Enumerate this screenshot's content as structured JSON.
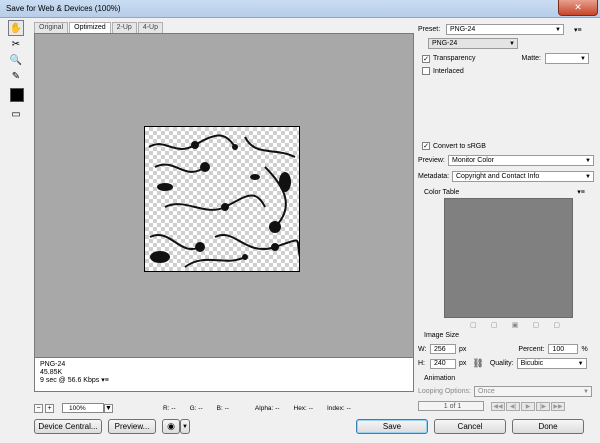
{
  "window": {
    "title": "Save for Web & Devices (100%)"
  },
  "view_tabs": [
    "Original",
    "Optimized",
    "2-Up",
    "4-Up"
  ],
  "info": {
    "format": "PNG-24",
    "size": "45.85K",
    "time": "9 sec @ 56.6 Kbps"
  },
  "zoom": {
    "value": "100%",
    "minus": "−",
    "plus": "+"
  },
  "readouts": {
    "r": "R: --",
    "g": "G: --",
    "b": "B: --",
    "alpha": "Alpha: --",
    "hex": "Hex: --",
    "index": "Index: --"
  },
  "preset": {
    "label": "Preset:",
    "value": "PNG-24"
  },
  "format_select": "PNG-24",
  "transparency": {
    "label": "Transparency",
    "checked": true
  },
  "matte": {
    "label": "Matte:"
  },
  "interlaced": {
    "label": "Interlaced",
    "checked": false
  },
  "convert_srgb": {
    "label": "Convert to sRGB",
    "checked": true
  },
  "preview_setting": {
    "label": "Preview:",
    "value": "Monitor Color"
  },
  "metadata": {
    "label": "Metadata:",
    "value": "Copyright and Contact Info"
  },
  "color_table": {
    "title": "Color Table"
  },
  "image_size": {
    "title": "Image Size",
    "w_label": "W:",
    "w_value": "256",
    "w_unit": "px",
    "h_label": "H:",
    "h_value": "240",
    "h_unit": "px",
    "percent_label": "Percent:",
    "percent_value": "100",
    "percent_unit": "%",
    "quality_label": "Quality:",
    "quality_value": "Bicubic"
  },
  "animation": {
    "title": "Animation",
    "looping_label": "Looping Options:",
    "looping_value": "Once",
    "frame_counter": "1 of 1"
  },
  "buttons": {
    "device_central": "Device Central...",
    "preview": "Preview...",
    "save": "Save",
    "cancel": "Cancel",
    "done": "Done"
  },
  "check_mark": "✓",
  "dropdown_arrow": "▼",
  "menu_icon": "▾≡"
}
